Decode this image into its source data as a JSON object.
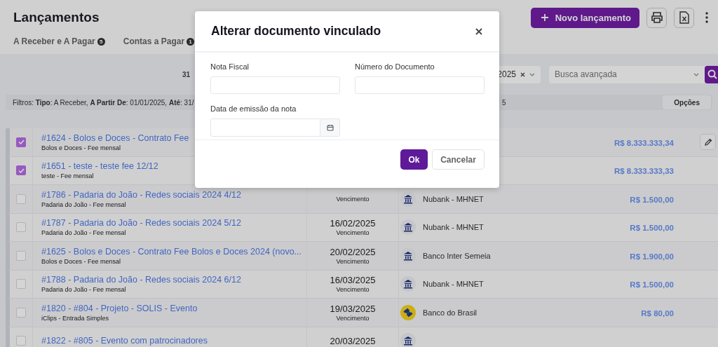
{
  "header": {
    "title": "Lançamentos",
    "new_button": "Novo lançamento"
  },
  "tabs": [
    {
      "label": "A Receber e A Pagar",
      "count": "5"
    },
    {
      "label": "Contas a Pagar",
      "count": "1"
    }
  ],
  "toolbar": {
    "result_count": "31",
    "filter_chip": "2025",
    "search": {
      "placeholder": "Busca avançada"
    }
  },
  "filters": {
    "text": "Filtros: **Tipo**: A Receber, **A Partir De**: 01/01/2025, **Até**: 31/",
    "text_2": "5",
    "options_button": "Opções"
  },
  "rows": [
    {
      "title": "#1624 - Bolos e Doces - Contrato Fee",
      "subtitle": "Bolos e Doces - Fee mensal",
      "amount": "R$ 8.333.333,34",
      "checked": true,
      "hovered": true
    },
    {
      "title": "#1651 - teste - teste fee 12/12",
      "subtitle": "teste - Fee mensal",
      "amount": "R$ 8.333.333,33",
      "checked": true,
      "hovered": false
    },
    {
      "title": "#1786 - Padaria do João - Redes sociais 2024 4/12",
      "subtitle": "Padaria do João - Fee mensal",
      "due_label": "Vencimento",
      "bank": {
        "name": "Nubank - MHNET",
        "kind": "generic"
      },
      "amount": "R$ 1.500,00",
      "checked": false,
      "hovered": false
    },
    {
      "title": "#1787 - Padaria do João - Redes sociais 2024 5/12",
      "subtitle": "Padaria do João - Fee mensal",
      "date": "16/02/2025",
      "due_label": "Vencimento",
      "bank": {
        "name": "Nubank - MHNET",
        "kind": "generic"
      },
      "amount": "R$ 1.500,00",
      "checked": false,
      "hovered": false
    },
    {
      "title": "#1625 - Bolos e Doces - Contrato Fee Bolos e Doces 2024 (novo...",
      "subtitle": "Bolos e Doces - Fee mensal",
      "date": "20/02/2025",
      "due_label": "Vencimento",
      "bank": {
        "name": "Banco Inter Semeia",
        "kind": "generic"
      },
      "amount": "R$ 1.900,00",
      "checked": false,
      "hovered": false
    },
    {
      "title": "#1788 - Padaria do João - Redes sociais 2024 6/12",
      "subtitle": "Padaria do João - Fee mensal",
      "date": "16/03/2025",
      "due_label": "Vencimento",
      "bank": {
        "name": "Nubank - MHNET",
        "kind": "generic"
      },
      "amount": "R$ 1.500,00",
      "checked": false,
      "hovered": false
    },
    {
      "title": "#1820 - #804 - Projeto - SOLIS - Evento",
      "subtitle": "iClips - Entrada Simples",
      "date": "19/03/2025",
      "due_label": "Vencimento",
      "bank": {
        "name": "Banco do Brasil",
        "kind": "bb"
      },
      "amount": "R$ 80,00",
      "checked": false,
      "hovered": false
    },
    {
      "title": "#1822 - #805 - Evento com patrocinadores",
      "date": "20/03/2025",
      "bank": {
        "kind": "generic"
      },
      "checked": false,
      "hovered": false
    }
  ],
  "modal": {
    "title": "Alterar documento vinculado",
    "fields": [
      {
        "label": "Nota Fiscal",
        "kind": "text"
      },
      {
        "label": "Número do Documento",
        "kind": "text"
      },
      {
        "label": "Data de emissão da nota",
        "kind": "date"
      }
    ],
    "buttons": [
      {
        "label": "Ok",
        "kind": "primary"
      },
      {
        "label": "Cancelar",
        "kind": "secondary"
      }
    ]
  }
}
